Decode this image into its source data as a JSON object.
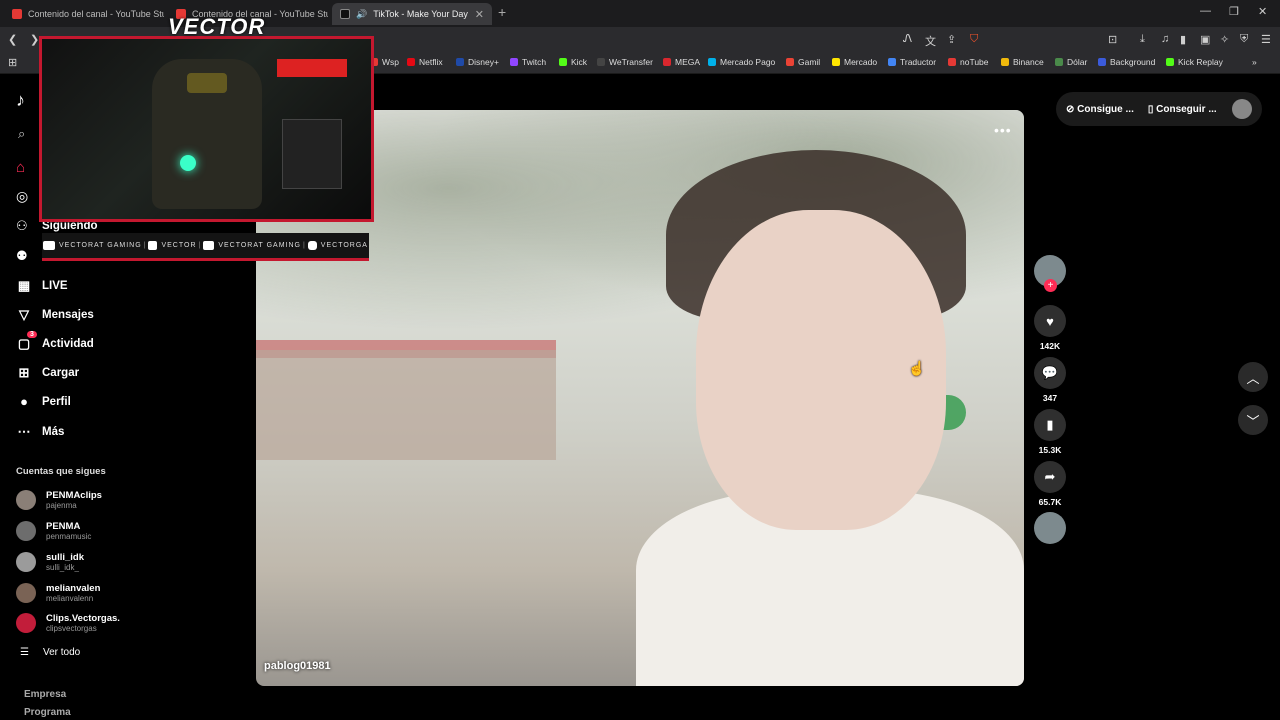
{
  "tabs": [
    {
      "title": "Contenido del canal - YouTube Studio"
    },
    {
      "title": "Contenido del canal - YouTube Studio"
    },
    {
      "title": "TikTok - Make Your Day"
    }
  ],
  "bookmarks": [
    {
      "label": "Wsp",
      "color": "#e53935"
    },
    {
      "label": "Netflix",
      "color": "#e50914"
    },
    {
      "label": "Disney+",
      "color": "#1f4aa8"
    },
    {
      "label": "Twitch",
      "color": "#9146ff"
    },
    {
      "label": "Kick",
      "color": "#53fc18"
    },
    {
      "label": "WeTransfer",
      "color": "#444444"
    },
    {
      "label": "MEGA",
      "color": "#d9272e"
    },
    {
      "label": "Mercado Pago",
      "color": "#00b1ea"
    },
    {
      "label": "Gamil",
      "color": "#ea4335"
    },
    {
      "label": "Mercado",
      "color": "#ffe600"
    },
    {
      "label": "Traductor",
      "color": "#4285f4"
    },
    {
      "label": "noTube",
      "color": "#e53935"
    },
    {
      "label": "Binance",
      "color": "#f0b90b"
    },
    {
      "label": "Dólar",
      "color": "#4a8a4a"
    },
    {
      "label": "Background",
      "color": "#3b5bdb"
    },
    {
      "label": "Kick Replay",
      "color": "#53fc18"
    }
  ],
  "overlay": {
    "brand": "VECTOR",
    "socials": [
      "VECTORAT GAMING",
      "VECTOR",
      "VECTORAT GAMING",
      "VECTORGA"
    ]
  },
  "sidebar": {
    "nav": [
      {
        "label": "Siguiendo",
        "icon": "following-icon"
      },
      {
        "label": "LIVE",
        "icon": "live-icon"
      },
      {
        "label": "Mensajes",
        "icon": "messages-icon"
      },
      {
        "label": "Actividad",
        "icon": "activity-icon",
        "badge": "3"
      },
      {
        "label": "Cargar",
        "icon": "upload-icon"
      },
      {
        "label": "Perfil",
        "icon": "profile-icon"
      },
      {
        "label": "Más",
        "icon": "more-icon"
      }
    ],
    "following_title": "Cuentas que sigues",
    "accounts": [
      {
        "name": "PENMAclips",
        "handle": "pajenma"
      },
      {
        "name": "PENMA",
        "handle": "penmamusic"
      },
      {
        "name": "sulli_idk",
        "handle": "sulli_idk_"
      },
      {
        "name": "melianvalen",
        "handle": "melianvalenn"
      },
      {
        "name": "Clips.Vectorgas.",
        "handle": "clipsvectorgas"
      }
    ],
    "see_all": "Ver todo",
    "footer": [
      "Empresa",
      "Programa"
    ]
  },
  "video": {
    "username": "pablog01981"
  },
  "actions": {
    "likes": "142K",
    "comments": "347",
    "saves": "15.3K",
    "shares": "65.7K"
  },
  "topright": {
    "coins": "Consigue ...",
    "app": "Conseguir ..."
  }
}
